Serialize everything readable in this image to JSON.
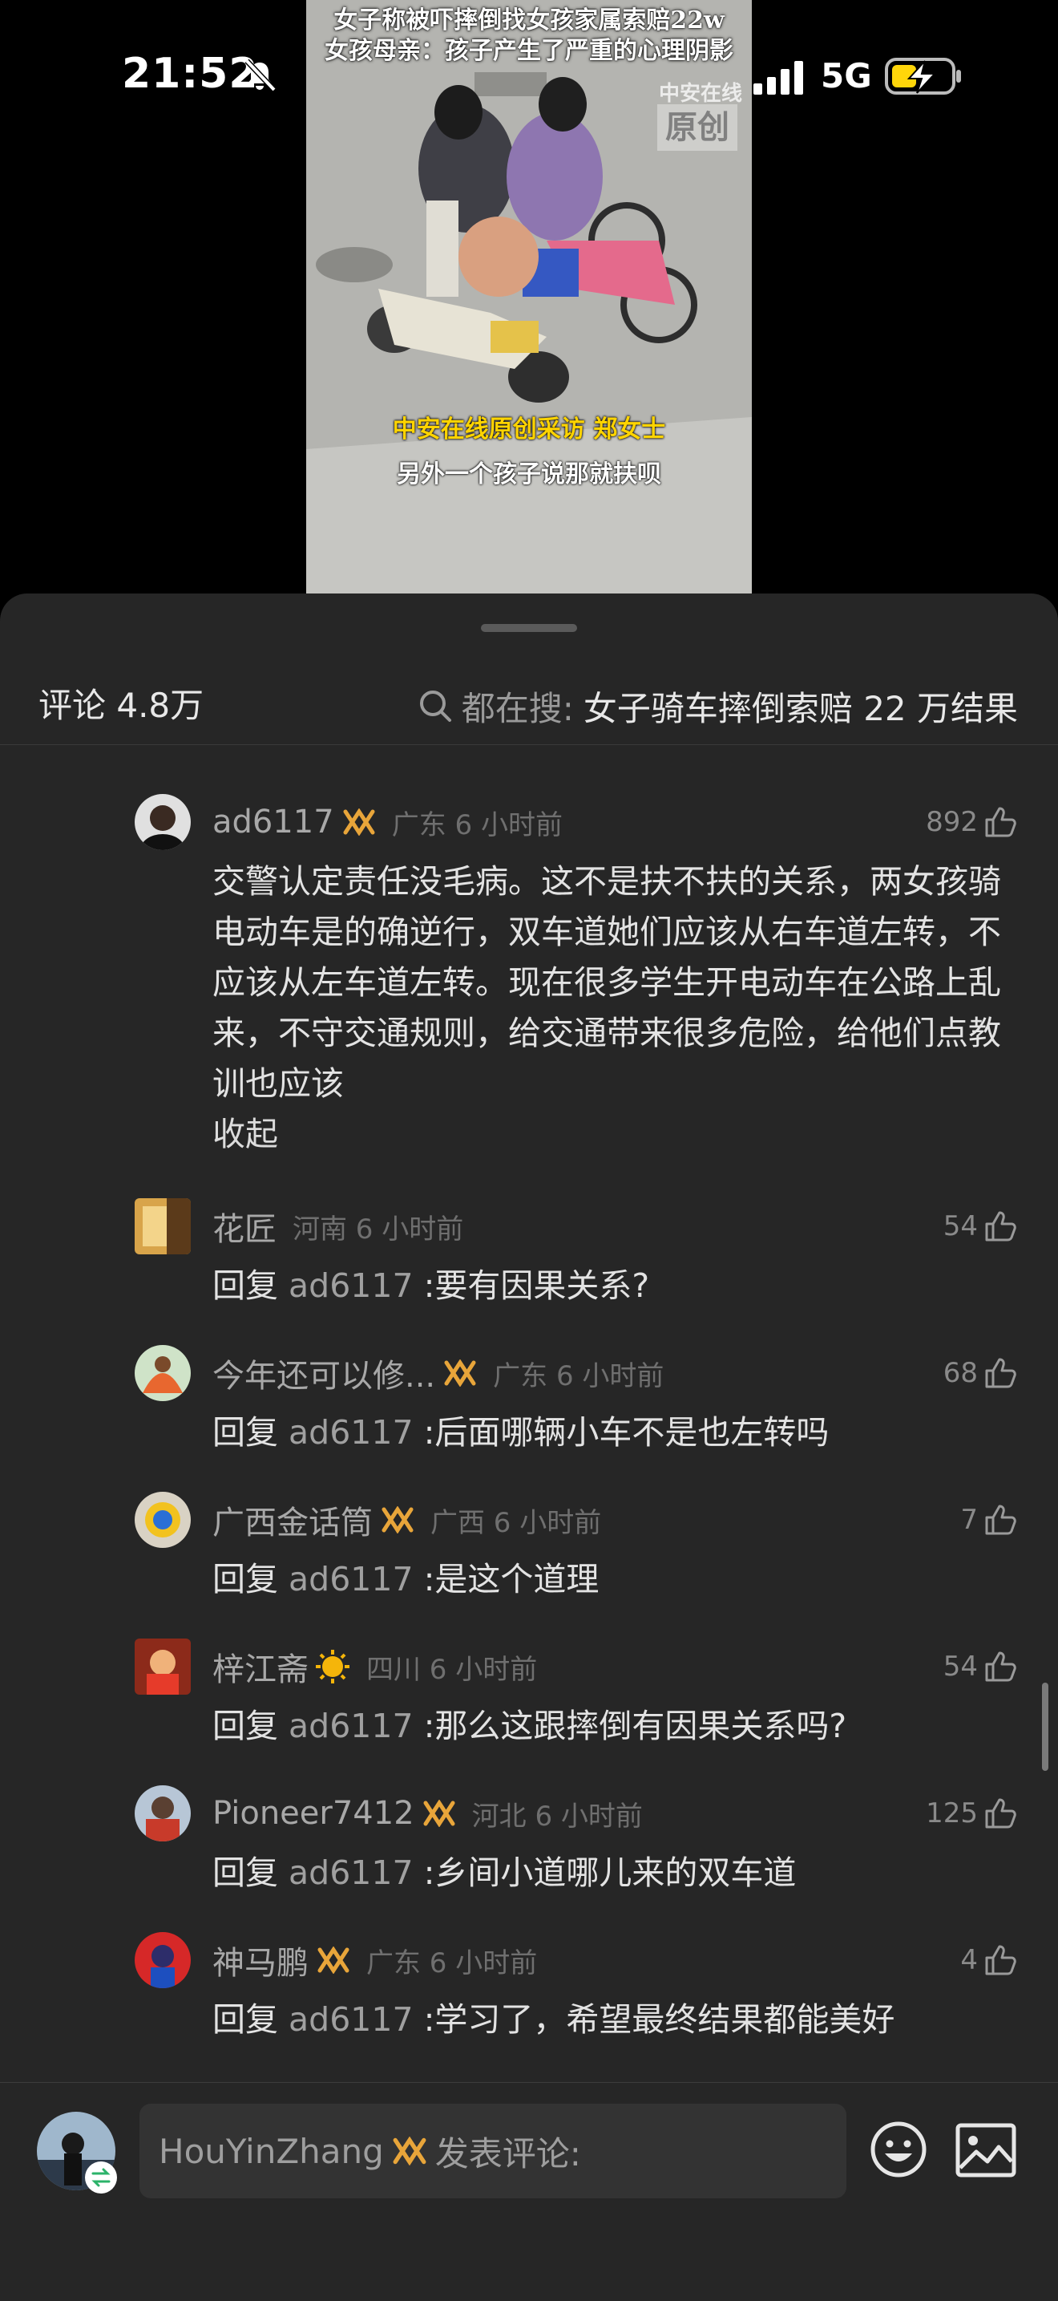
{
  "status": {
    "time": "21:52",
    "network": "5G",
    "mute_icon": "bell-off-icon",
    "signal_icon": "signal-bars-icon",
    "battery_icon": "battery-charging-icon"
  },
  "video": {
    "title_line1": "女子称被吓摔倒找女孩家属索赔22w",
    "title_line2": "女孩母亲：孩子产生了严重的心理阴影",
    "watermark_top": "中安在线",
    "watermark_box": "原创",
    "caption_yellow": "中安在线原创采访 郑女士",
    "caption_white": "另外一个孩子说那就扶呗"
  },
  "header": {
    "comment_count": "评论 4.8万",
    "search_prefix": "都在搜:",
    "search_term": "女子骑车摔倒索赔 22 万结果"
  },
  "comments": [
    {
      "user": "ad6117",
      "location": "广东 6 小时前",
      "likes": "892",
      "text": "交警认定责任没毛病。这不是扶不扶的关系，两女孩骑电动车是的确逆行，双车道她们应该从右车道左转，不应该从左车道左转。现在很多学生开电动车在公路上乱来，不守交通规则，给交通带来很多危险，给他们点教训也应该",
      "collapse": "收起"
    },
    {
      "user": "花匠",
      "location": "河南 6 小时前",
      "likes": "54",
      "reply_prefix": "回复",
      "reply_to": "ad6117",
      "text": ":要有因果关系?"
    },
    {
      "user": "今年还可以修...",
      "location": "广东 6 小时前",
      "likes": "68",
      "reply_prefix": "回复",
      "reply_to": "ad6117",
      "text": ":后面哪辆小车不是也左转吗"
    },
    {
      "user": "广西金话筒",
      "location": "广西 6 小时前",
      "likes": "7",
      "reply_prefix": "回复",
      "reply_to": "ad6117",
      "text": ":是这个道理"
    },
    {
      "user": "梓江斋",
      "location": "四川 6 小时前",
      "likes": "54",
      "reply_prefix": "回复",
      "reply_to": "ad6117",
      "text": ":那么这跟摔倒有因果关系吗?"
    },
    {
      "user": "Pioneer7412",
      "location": "河北 6 小时前",
      "likes": "125",
      "reply_prefix": "回复",
      "reply_to": "ad6117",
      "text": ":乡间小道哪儿来的双车道"
    },
    {
      "user": "神马鹏",
      "location": "广东 6 小时前",
      "likes": "4",
      "reply_prefix": "回复",
      "reply_to": "ad6117",
      "text": ":学习了，希望最终结果都能美好"
    }
  ],
  "input": {
    "user": "HouYinZhang",
    "placeholder": "发表评论:"
  },
  "colors": {
    "sheet_bg": "#262626",
    "badge": "#e8a53a",
    "text_secondary": "#a8a8a8"
  }
}
